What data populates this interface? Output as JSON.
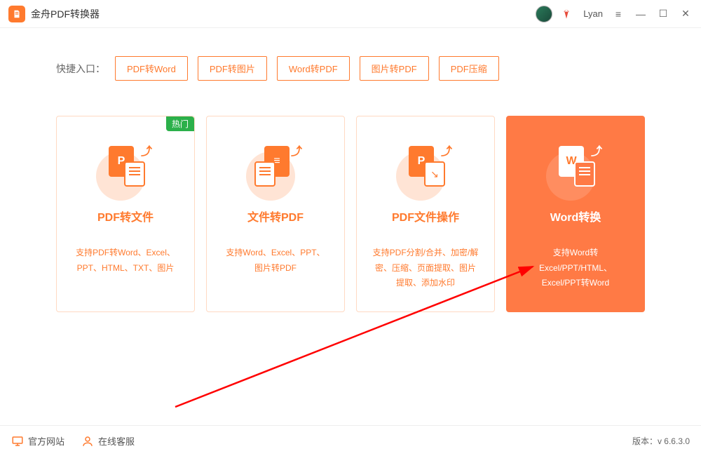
{
  "app": {
    "title": "金舟PDF转换器"
  },
  "user": {
    "name": "Lyan"
  },
  "quick": {
    "label": "快捷入口：",
    "items": [
      "PDF转Word",
      "PDF转图片",
      "Word转PDF",
      "图片转PDF",
      "PDF压缩"
    ]
  },
  "cards": [
    {
      "badge": "热门",
      "icon_letter": "P",
      "title": "PDF转文件",
      "desc": "支持PDF转Word、Excel、PPT、HTML、TXT、图片"
    },
    {
      "icon_letter": "",
      "title": "文件转PDF",
      "desc": "支持Word、Excel、PPT、图片转PDF"
    },
    {
      "icon_letter": "P",
      "title": "PDF文件操作",
      "desc": "支持PDF分割/合并、加密/解密、压缩、页面提取、图片提取、添加水印"
    },
    {
      "icon_letter": "W",
      "title": "Word转换",
      "desc": "支持Word转Excel/PPT/HTML、Excel/PPT转Word"
    }
  ],
  "footer": {
    "website": "官方网站",
    "support": "在线客服",
    "version_label": "版本：",
    "version": "v 6.6.3.0"
  }
}
